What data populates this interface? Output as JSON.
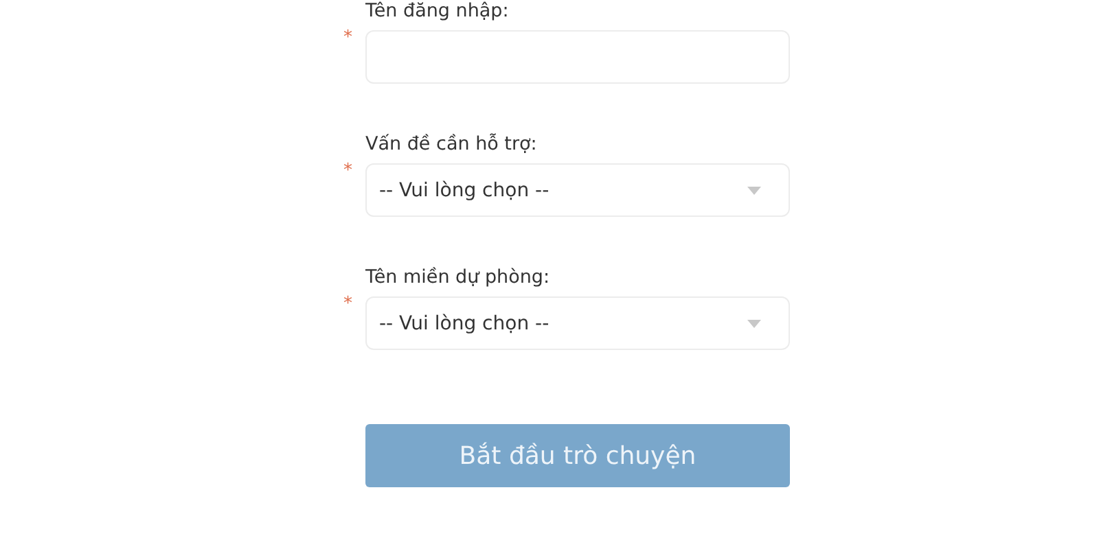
{
  "fields": [
    {
      "label": "Tên đăng nhập:",
      "kind": "text",
      "mark": "*"
    },
    {
      "label": "Vấn đề cần hỗ trợ:",
      "kind": "select",
      "mark": "*",
      "placeholder": "-- Vui lòng chọn --"
    },
    {
      "label": "Tên miền dự phòng:",
      "kind": "select",
      "mark": "*",
      "placeholder": "-- Vui lòng chọn --"
    }
  ],
  "submit": {
    "label": "Bắt đầu trò chuyện",
    "disabled": true
  }
}
